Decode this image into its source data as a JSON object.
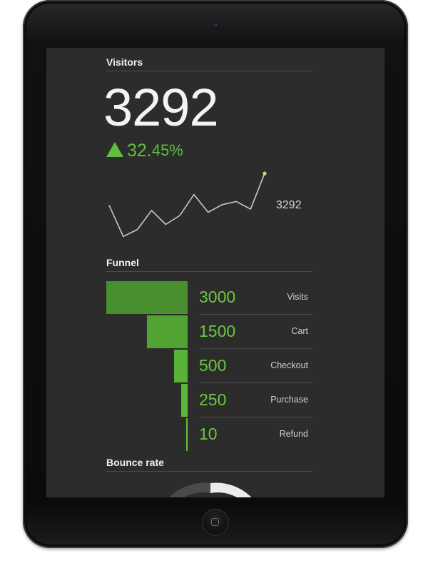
{
  "visitors": {
    "title": "Visitors",
    "count": "3292",
    "change_main": "32.",
    "change_rest": "45%",
    "change_icon": "triangle-up-icon",
    "sparkline_values": [
      92,
      43,
      54,
      84,
      62,
      76,
      109,
      81,
      93,
      98,
      86,
      142
    ],
    "sparkline_label": "3292"
  },
  "funnel": {
    "title": "Funnel",
    "rows": [
      {
        "value": "3000",
        "label": "Visits"
      },
      {
        "value": "1500",
        "label": "Cart"
      },
      {
        "value": "500",
        "label": "Checkout"
      },
      {
        "value": "250",
        "label": "Purchase"
      },
      {
        "value": "10",
        "label": "Refund"
      }
    ]
  },
  "bounce": {
    "title": "Bounce rate"
  },
  "colors": {
    "accent_green": "#5fbf3f",
    "screen_bg": "#2c2c2c",
    "text": "#f3f3f3"
  }
}
